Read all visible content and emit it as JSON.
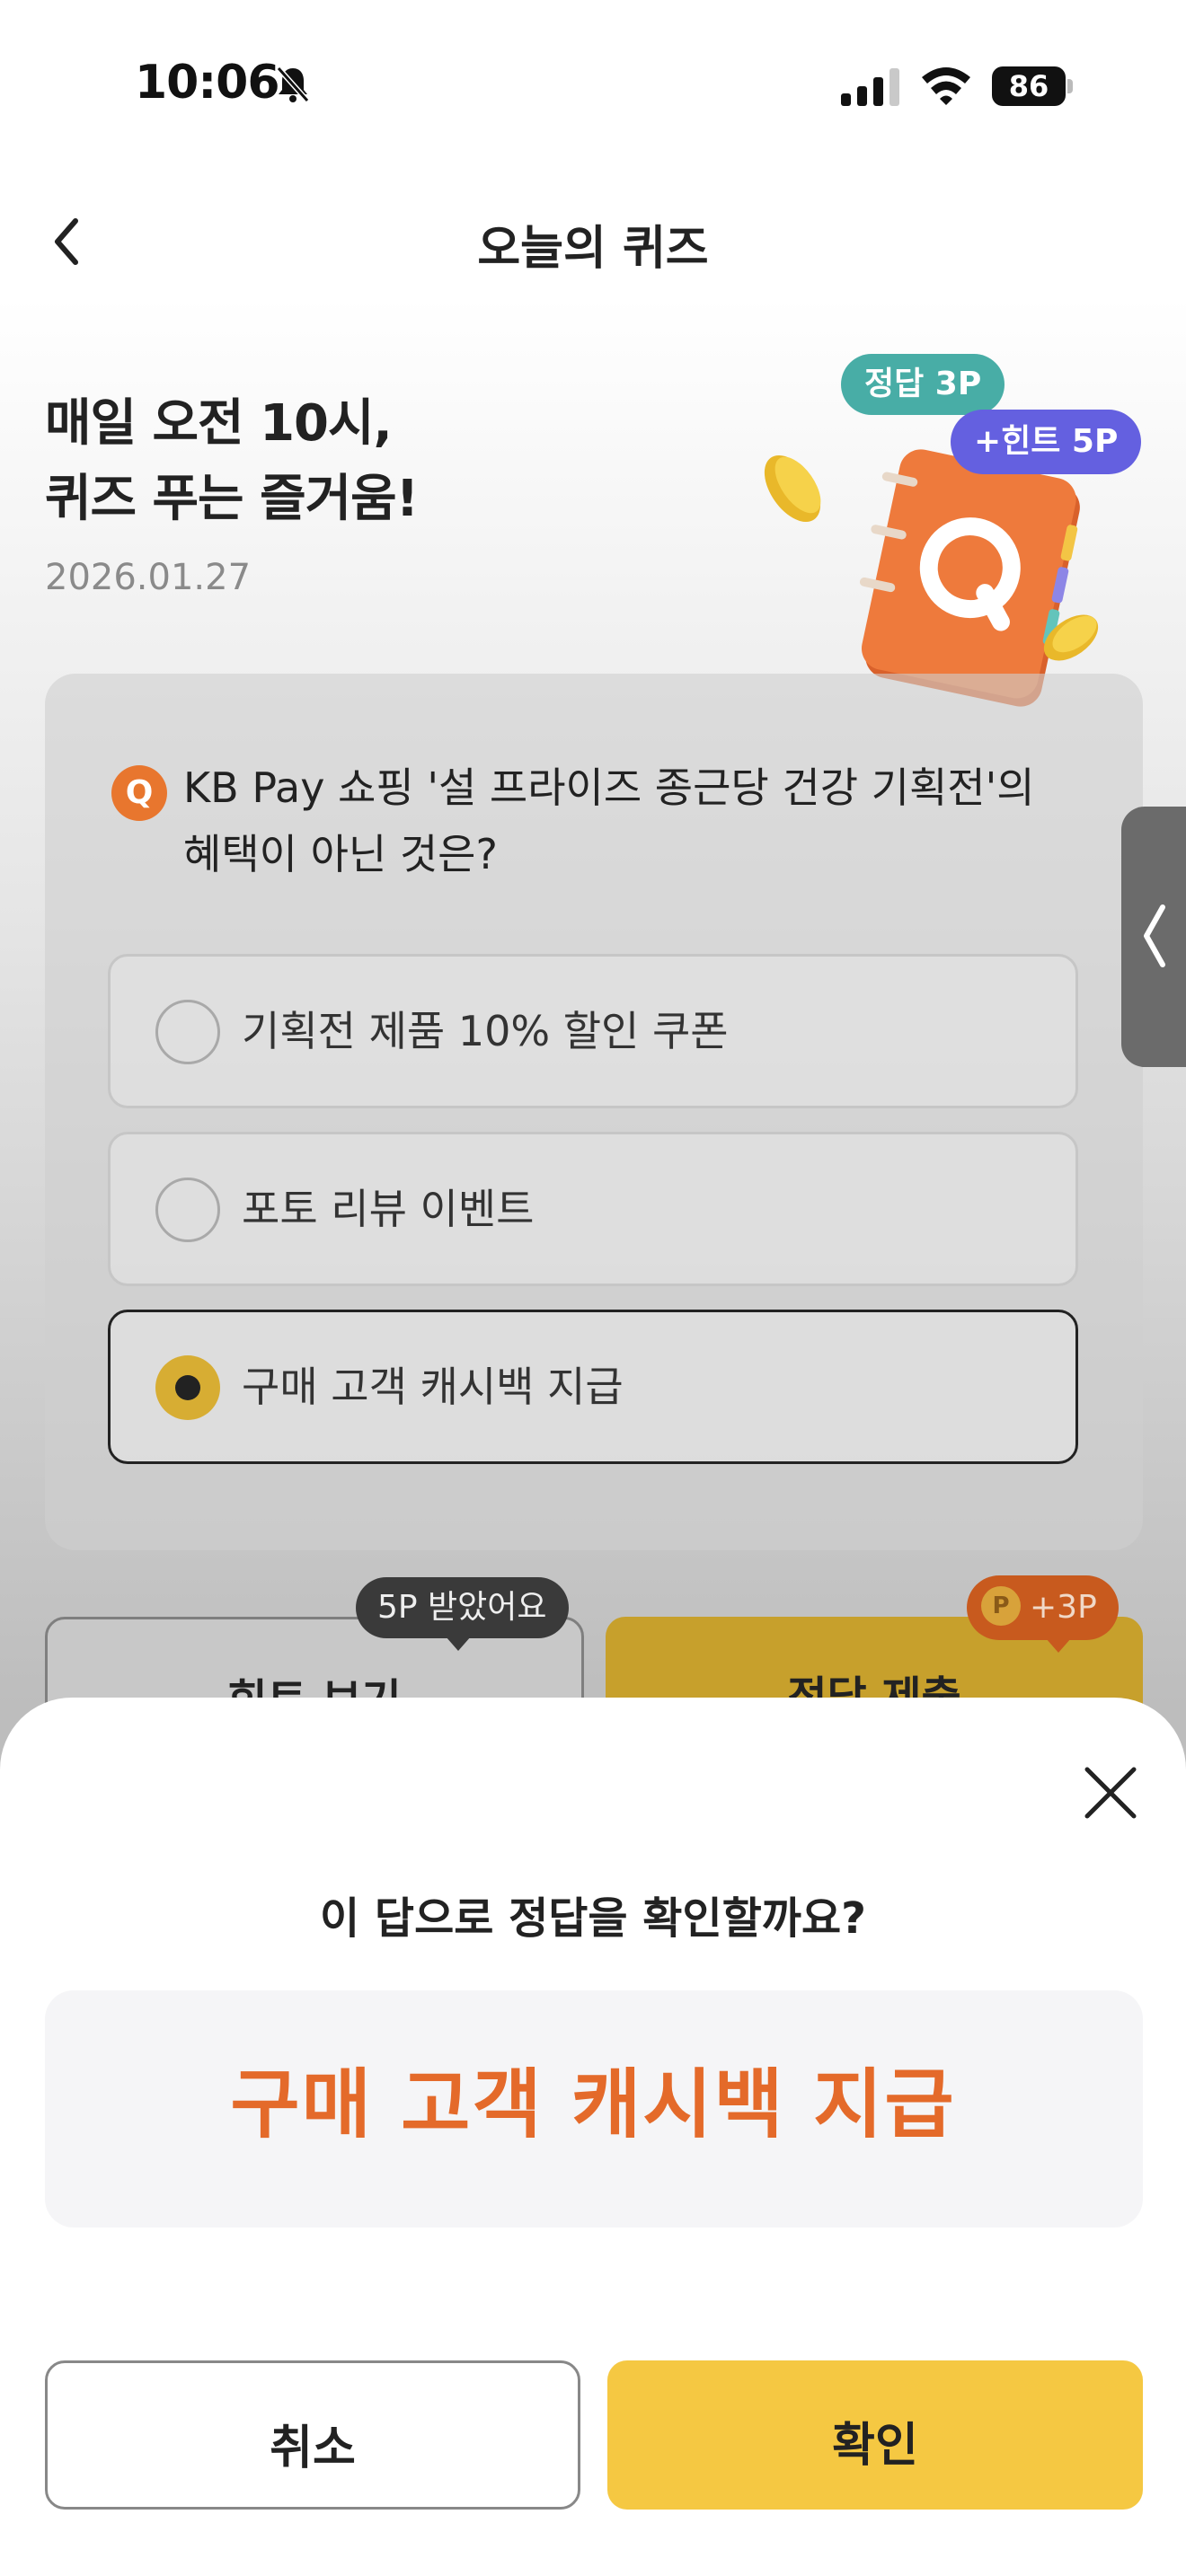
{
  "status_bar": {
    "time": "10:06",
    "battery": "86"
  },
  "nav": {
    "title": "오늘의 퀴즈",
    "back_icon": "chevron-left-icon"
  },
  "header": {
    "headline_line1": "매일 오전 10시,",
    "headline_line2": "퀴즈 푸는 즐거움!",
    "date": "2026.01.27",
    "tag_answer": "정답 3P",
    "tag_hint": "+힌트 5P"
  },
  "quiz": {
    "badge": "Q",
    "question": "KB Pay 쇼핑 '설 프라이즈 종근당 건강 기획전'의 혜택이 아닌 것은?",
    "options": [
      {
        "label": "기획전 제품 10% 할인 쿠폰",
        "selected": false
      },
      {
        "label": "포토 리뷰 이벤트",
        "selected": false
      },
      {
        "label": "구매 고객 캐시백 지급",
        "selected": true
      }
    ]
  },
  "actions": {
    "hint_label": "힌트 보기",
    "hint_tooltip": "5P 받았어요",
    "submit_label": "정답 제출",
    "submit_tooltip_coin": "P",
    "submit_tooltip": "+3P"
  },
  "sheet": {
    "title": "이 답으로 정답을 확인할까요?",
    "answer": "구매 고객 캐시백 지급",
    "cancel_label": "취소",
    "confirm_label": "확인"
  },
  "colors": {
    "accent_yellow": "#f5c842",
    "answer_orange": "#e46a2a",
    "tag_teal": "#48ada6",
    "tag_purple": "#6460e0"
  }
}
